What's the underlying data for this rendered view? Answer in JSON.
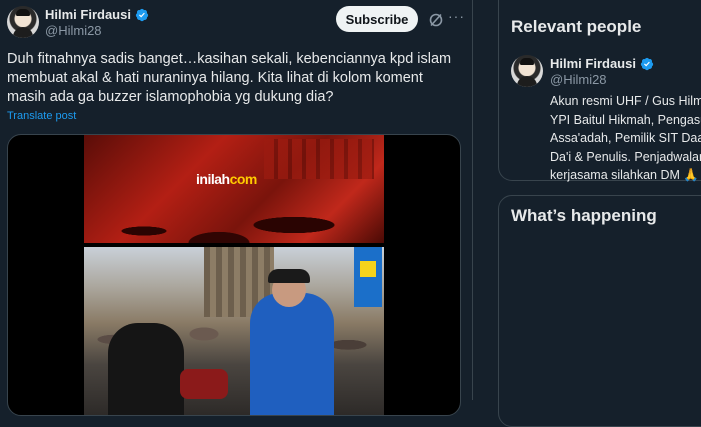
{
  "post": {
    "author_name": "Hilmi Firdausi",
    "author_handle": "@Hilmi28",
    "subscribe_label": "Subscribe",
    "more_label": "···",
    "text": "Duh fitnahnya sadis banget…kasihan sekali, kebenciannya kpd islam membuat akal & hati nuraninya hilang. Kita lihat di kolom koment masih ada ga buzzer islamophobia yg dukung dia?",
    "translate_label": "Translate post",
    "media": {
      "watermark_main": "inilah",
      "watermark_suffix": "com"
    }
  },
  "sidebar": {
    "relevant_people": {
      "title": "Relevant people",
      "person": {
        "name": "Hilmi Firdausi",
        "handle": "@Hilmi28",
        "bio_lines": [
          "Akun resmi UHF / Gus Hilm",
          "YPI Baitul Hikmah, Pengasu",
          "Assa'adah, Pemilik SIT Daar",
          "Da'i & Penulis. Penjadwalan",
          "kerjasama silahkan DM 🙏"
        ]
      }
    },
    "whats_happening": {
      "title": "What’s happening"
    }
  },
  "colors": {
    "background": "#15202b",
    "accent": "#1d9bf0",
    "verified": "#1d9bf0"
  }
}
